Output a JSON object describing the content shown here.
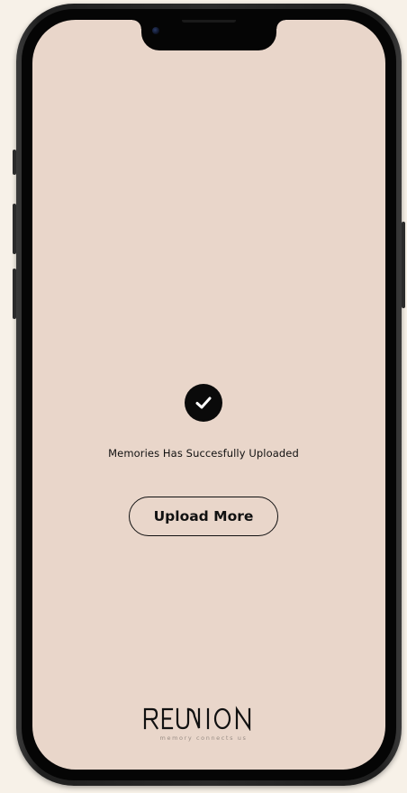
{
  "status": {
    "message": "Memories Has Succesfully Uploaded",
    "icon": "check-circle-icon"
  },
  "actions": {
    "upload_more_label": "Upload More"
  },
  "branding": {
    "logo_text": "REUNION",
    "tagline": "memory connects us"
  },
  "colors": {
    "screen_background": "#e9d6ca",
    "page_background": "#f7f1e8",
    "text": "#111111",
    "tagline": "#9a8e86"
  }
}
